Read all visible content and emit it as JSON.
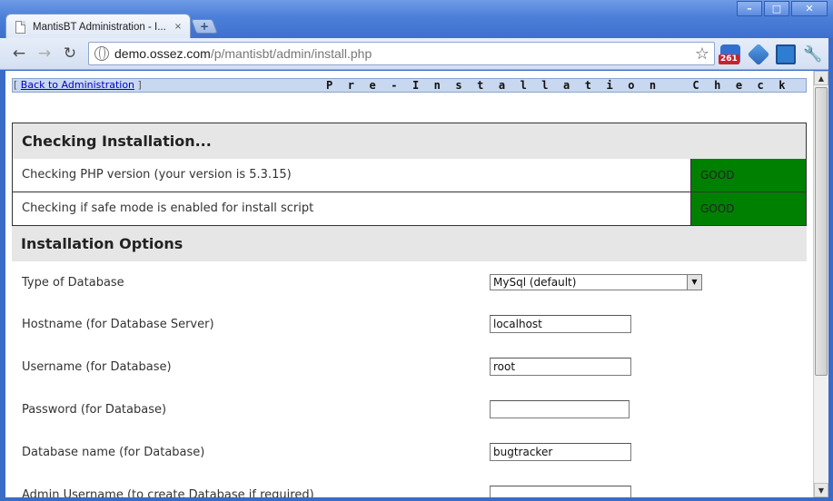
{
  "window": {
    "tab_title": "MantisBT Administration - I...",
    "tab_close": "×",
    "new_tab": "+",
    "minimize": "–",
    "maximize": "□",
    "close": "✕"
  },
  "toolbar": {
    "back": "←",
    "forward": "→",
    "reload": "↻",
    "url_host": "demo.ossez.com",
    "url_path": "/p/mantisbt/admin/install.php",
    "star": "☆",
    "mail_badge": "261",
    "wrench": "🔧"
  },
  "adminbar": {
    "open_bracket": "[ ",
    "back_link": "Back to Administration",
    "close_bracket": " ]",
    "title": "Pre-Installation Check"
  },
  "checking": {
    "heading": "Checking Installation...",
    "rows": [
      {
        "label": "Checking PHP version (your version is 5.3.15)",
        "status": "GOOD"
      },
      {
        "label": "Checking if safe mode is enabled for install script",
        "status": "GOOD"
      }
    ]
  },
  "options": {
    "heading": "Installation Options",
    "db_type_label": "Type of Database",
    "db_type_value": "MySql (default)",
    "hostname_label": "Hostname (for Database Server)",
    "hostname_value": "localhost",
    "username_label": "Username (for Database)",
    "username_value": "root",
    "password_label": "Password (for Database)",
    "password_value": "",
    "dbname_label": "Database name (for Database)",
    "dbname_value": "bugtracker",
    "admin_username_label": "Admin Username (to create Database if required)",
    "admin_username_value": ""
  },
  "colors": {
    "good_status": "#008000",
    "section_bg": "#e6e6e6",
    "adminbar_bg": "#c8d8f0",
    "link": "#0000cc"
  }
}
